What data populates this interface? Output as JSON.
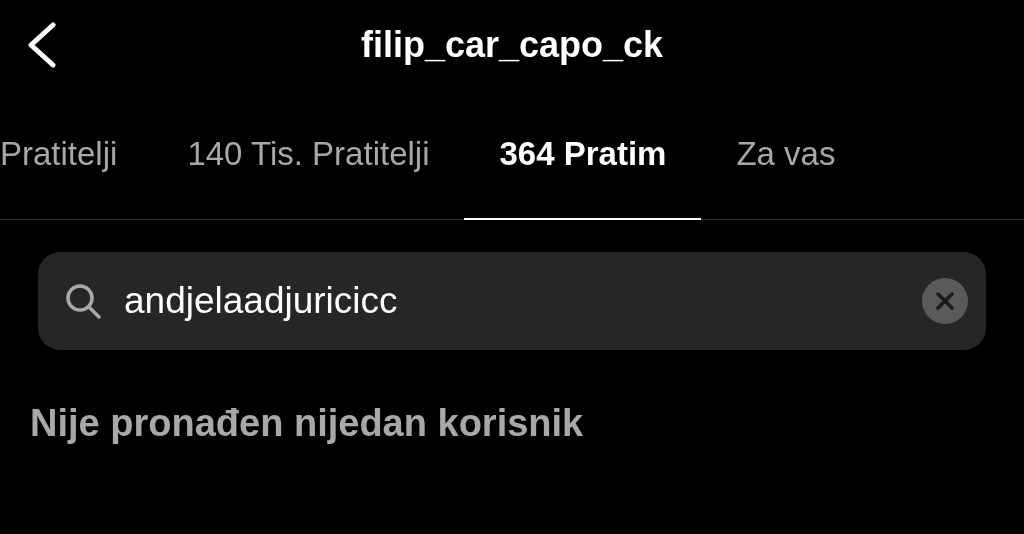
{
  "header": {
    "title": "filip_car_capo_ck"
  },
  "tabs": [
    {
      "label": "Pratitelji",
      "selected": false
    },
    {
      "label": "140 Tis. Pratitelji",
      "selected": false
    },
    {
      "label": "364 Pratim",
      "selected": true
    },
    {
      "label": "Za vas",
      "selected": false
    }
  ],
  "search": {
    "value": "andjelaadjuricicc"
  },
  "message": "Nije pronađen nijedan korisnik"
}
